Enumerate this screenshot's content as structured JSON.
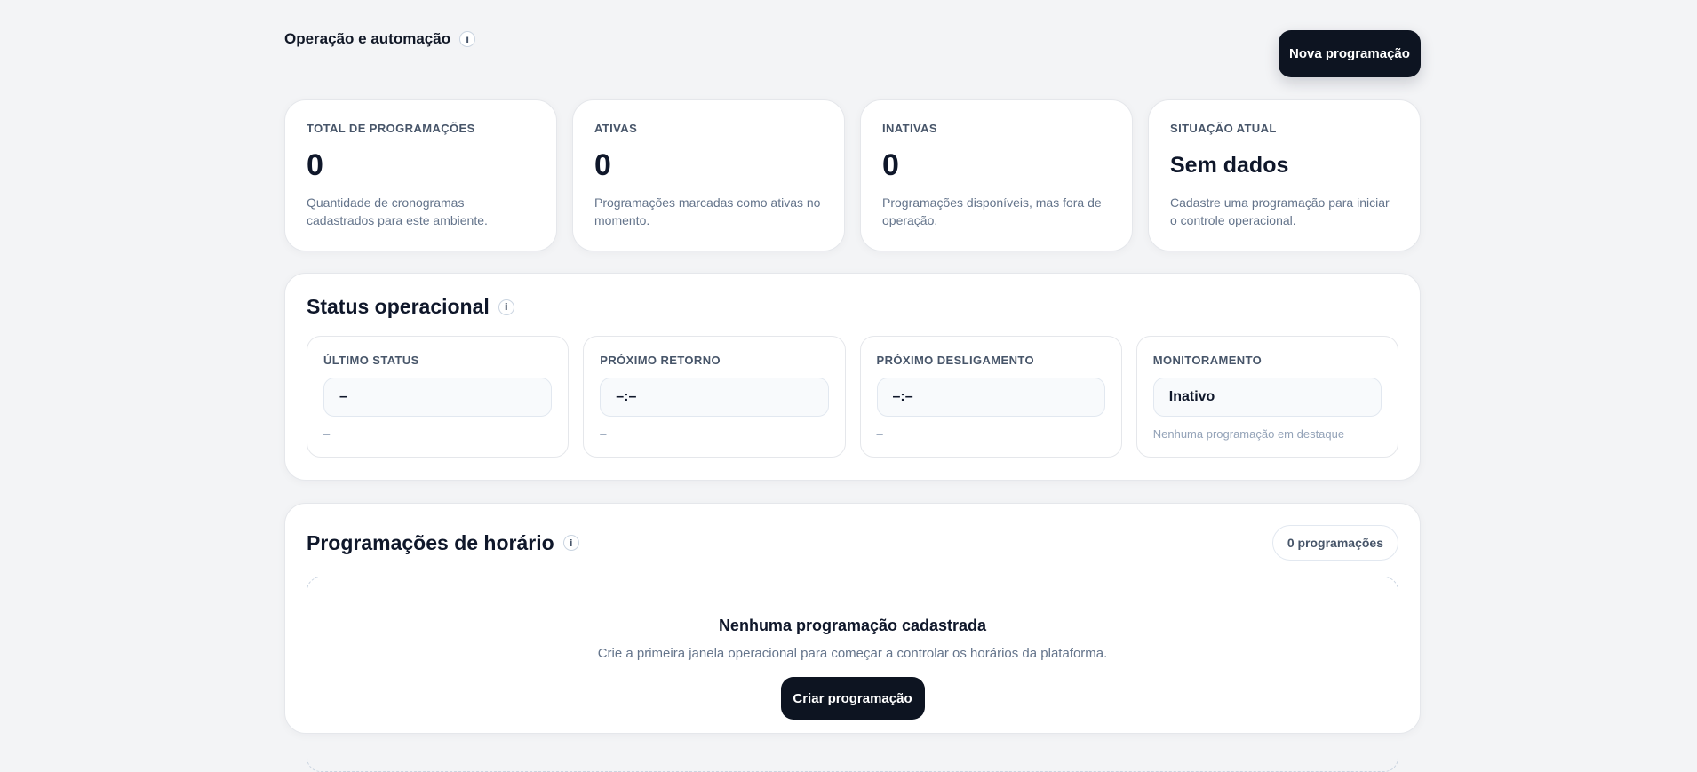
{
  "header": {
    "title": "Operação e automação",
    "info_glyph": "i",
    "new_schedule_label": "Nova programação"
  },
  "metrics": [
    {
      "label": "TOTAL DE PROGRAMAÇÕES",
      "value": "0",
      "description": "Quantidade de cronogramas cadastrados para este ambiente."
    },
    {
      "label": "ATIVAS",
      "value": "0",
      "description": "Programações marcadas como ativas no momento."
    },
    {
      "label": "INATIVAS",
      "value": "0",
      "description": "Programações disponíveis, mas fora de operação."
    },
    {
      "label": "SITUAÇÃO ATUAL",
      "value": "Sem dados",
      "description": "Cadastre uma programação para iniciar o controle operacional."
    }
  ],
  "status": {
    "title": "Status operacional",
    "boxes": [
      {
        "label": "ÚLTIMO STATUS",
        "value": "–",
        "sub": "–"
      },
      {
        "label": "PRÓXIMO RETORNO",
        "value": "–:–",
        "sub": "–"
      },
      {
        "label": "PRÓXIMO DESLIGAMENTO",
        "value": "–:–",
        "sub": "–"
      },
      {
        "label": "MONITORAMENTO",
        "value": "Inativo",
        "sub": "Nenhuma programação em destaque"
      }
    ]
  },
  "schedules": {
    "title": "Programações de horário",
    "count_label": "0 programações",
    "empty_title": "Nenhuma programação cadastrada",
    "empty_description": "Crie a primeira janela operacional para começar a controlar os horários da plataforma.",
    "create_label": "Criar programação"
  }
}
